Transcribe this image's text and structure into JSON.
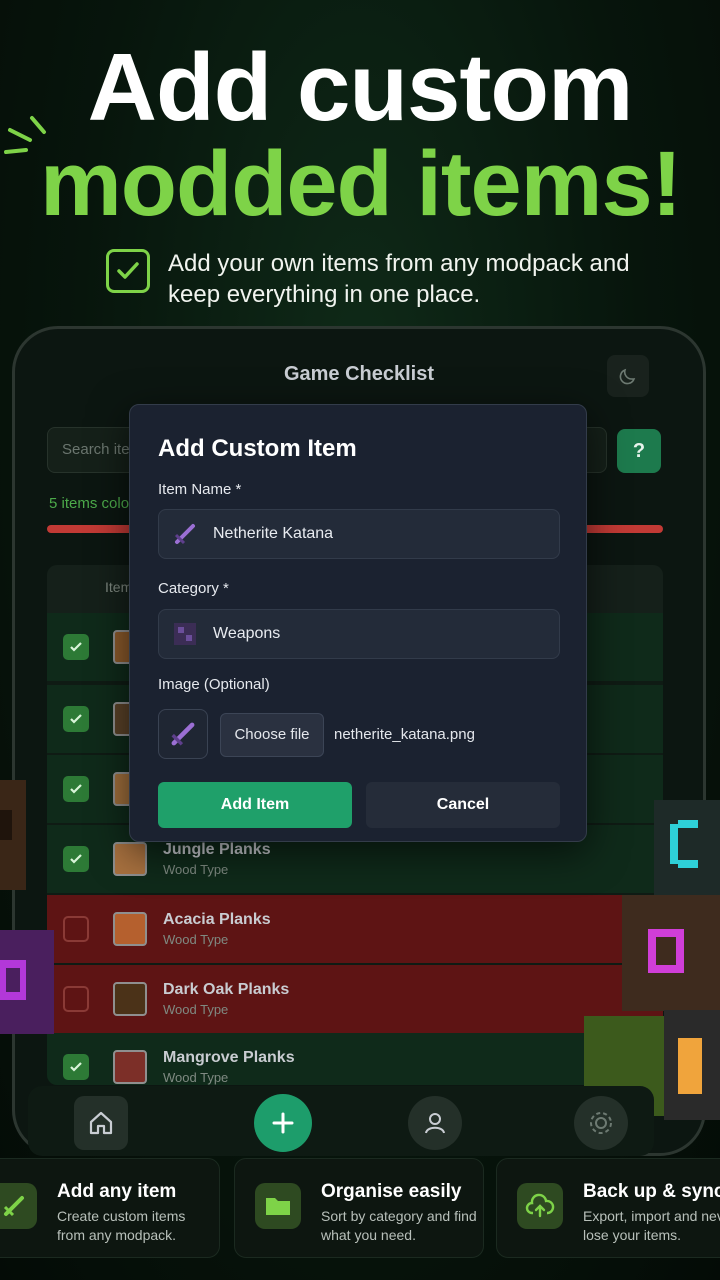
{
  "hero": {
    "line1": "Add custom",
    "line2": "modded items!",
    "subtitle": "Add your own items from any modpack and keep everything in one place."
  },
  "app": {
    "title": "Game Checklist",
    "search_placeholder": "Search ite",
    "help_label": "?",
    "progress_text": "5 items colo",
    "table_header": "Item",
    "rows": [
      {
        "name": "",
        "sub": "",
        "checked": true,
        "tile": "#8b5a2b"
      },
      {
        "name": "",
        "sub": "",
        "checked": true,
        "tile": "#5a4228"
      },
      {
        "name": "",
        "sub": "",
        "checked": true,
        "tile": "#a06f3c"
      },
      {
        "name": "Jungle Planks",
        "sub": "Wood Type",
        "checked": true,
        "tile": "#a8713f"
      },
      {
        "name": "Acacia Planks",
        "sub": "Wood Type",
        "checked": false,
        "tile": "#b5602e"
      },
      {
        "name": "Dark Oak Planks",
        "sub": "Wood Type",
        "checked": false,
        "tile": "#4b3218"
      },
      {
        "name": "Mangrove Planks",
        "sub": "Wood Type",
        "checked": true,
        "tile": "#7c2f28"
      }
    ]
  },
  "modal": {
    "title": "Add Custom Item",
    "item_name_label": "Item Name *",
    "item_name_value": "Netherite Katana",
    "category_label": "Category *",
    "category_value": "Weapons",
    "image_label": "Image (Optional)",
    "choose_file": "Choose file",
    "file_name": "netherite_katana.png",
    "add_button": "Add Item",
    "cancel_button": "Cancel"
  },
  "features": [
    {
      "title": "Add any item",
      "desc": "Create custom items from any modpack.",
      "icon": "sword-icon"
    },
    {
      "title": "Organise easily",
      "desc": "Sort by category and find what you need.",
      "icon": "folder-icon"
    },
    {
      "title": "Back up & sync",
      "desc": "Export, import and never lose your items.",
      "icon": "cloud-upload-icon"
    }
  ],
  "colors": {
    "accent_green": "#7ed348",
    "button_green": "#1fa06a",
    "missing_red": "#5e1414"
  }
}
